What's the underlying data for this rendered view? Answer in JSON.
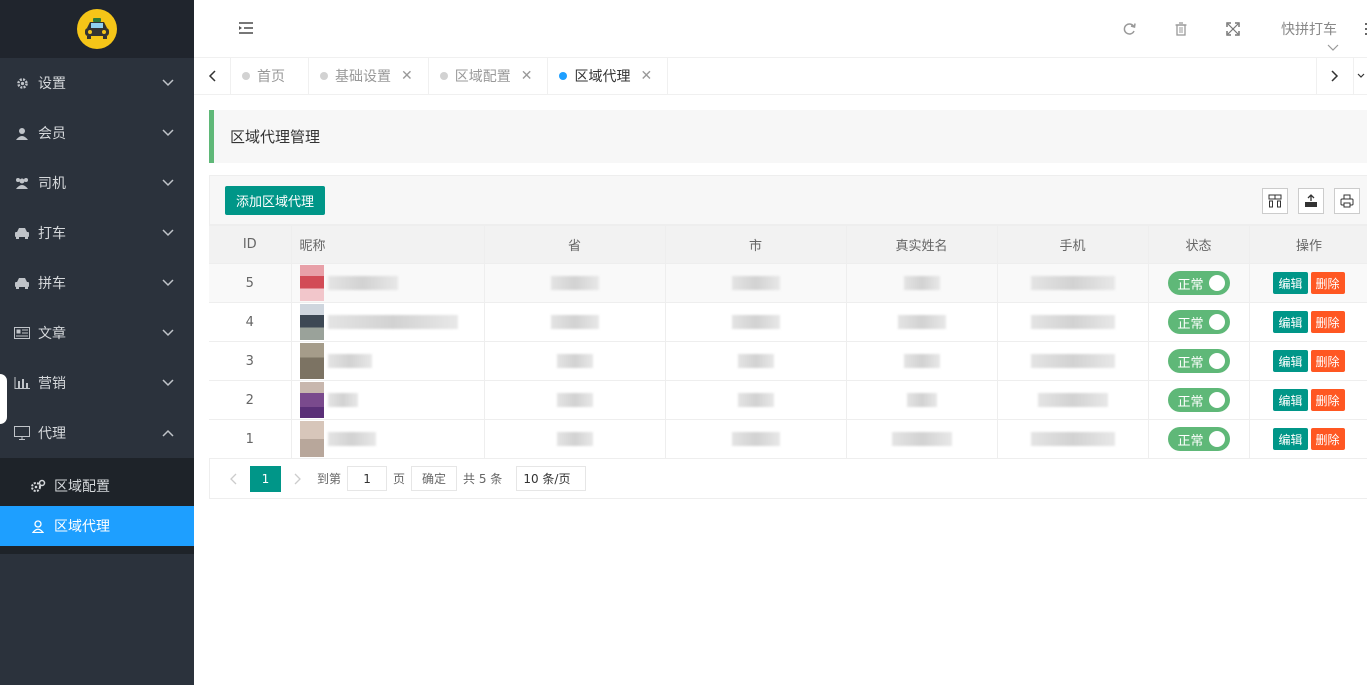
{
  "colors": {
    "sidebar": "#2b323c",
    "accent": "#009688",
    "active_blue": "#1e9fff",
    "success": "#5fb878",
    "danger": "#ff5722"
  },
  "sidebar": {
    "items": [
      {
        "label": "设置",
        "icon": "gear-icon"
      },
      {
        "label": "会员",
        "icon": "user-icon"
      },
      {
        "label": "司机",
        "icon": "users-icon"
      },
      {
        "label": "打车",
        "icon": "car-icon"
      },
      {
        "label": "拼车",
        "icon": "car-icon"
      },
      {
        "label": "文章",
        "icon": "newspaper-icon"
      },
      {
        "label": "营销",
        "icon": "bar-chart-icon"
      },
      {
        "label": "代理",
        "icon": "monitor-icon"
      }
    ],
    "submenu": [
      {
        "label": "区域配置",
        "icon": "gears-icon"
      },
      {
        "label": "区域代理",
        "icon": "person-icon"
      }
    ]
  },
  "header": {
    "user": "快拼打车"
  },
  "tabs": [
    {
      "label": "首页"
    },
    {
      "label": "基础设置"
    },
    {
      "label": "区域配置"
    },
    {
      "label": "区域代理"
    }
  ],
  "page": {
    "title": "区域代理管理",
    "add_button": "添加区域代理"
  },
  "table": {
    "headers": [
      "ID",
      "昵称",
      "省",
      "市",
      "真实姓名",
      "手机",
      "状态",
      "操作"
    ],
    "rows": [
      {
        "id": "5",
        "status": "正常"
      },
      {
        "id": "4",
        "status": "正常"
      },
      {
        "id": "3",
        "status": "正常"
      },
      {
        "id": "2",
        "status": "正常"
      },
      {
        "id": "1",
        "status": "正常"
      }
    ],
    "edit_label": "编辑",
    "delete_label": "删除"
  },
  "pager": {
    "current": "1",
    "goto_label": "到第",
    "page_input": "1",
    "page_label": "页",
    "confirm": "确定",
    "total": "共 5 条",
    "per_page": "10 条/页"
  }
}
